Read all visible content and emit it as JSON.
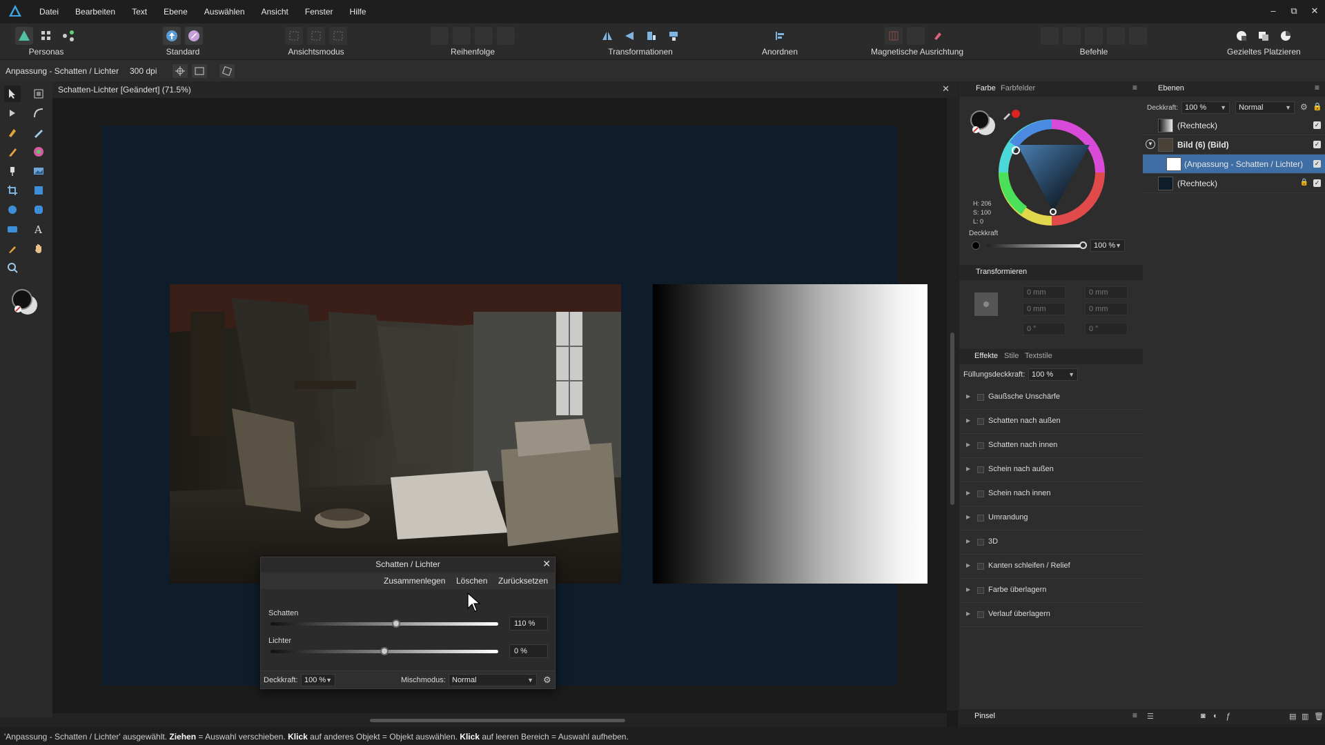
{
  "app": {
    "menus": [
      "Datei",
      "Bearbeiten",
      "Text",
      "Ebene",
      "Auswählen",
      "Ansicht",
      "Fenster",
      "Hilfe"
    ],
    "window_controls": [
      "–",
      "⧉",
      "✕"
    ]
  },
  "toolbar": {
    "personas": "Personas",
    "standard": "Standard",
    "ansichtsmodus": "Ansichtsmodus",
    "reihenfolge": "Reihenfolge",
    "transformationen": "Transformationen",
    "anordnen": "Anordnen",
    "magnetische_ausrichtung": "Magnetische Ausrichtung",
    "befehle": "Befehle",
    "gezieltes_platzieren": "Gezieltes Platzieren"
  },
  "context": {
    "title": "Anpassung - Schatten / Lichter",
    "dpi": "300 dpi"
  },
  "document": {
    "tab_title": "Schatten-Lichter [Geändert] (71.5%)",
    "close": "✕"
  },
  "dialog": {
    "title": "Schatten / Lichter",
    "close": "✕",
    "merge": "Zusammenlegen",
    "delete": "Löschen",
    "reset": "Zurücksetzen",
    "shadows_label": "Schatten",
    "shadows_value": "110 %",
    "shadows_level": 0.55,
    "highlights_label": "Lichter",
    "highlights_value": "0 %",
    "highlights_level": 0.5,
    "opacity_label": "Deckkraft:",
    "opacity_value": "100 %",
    "blend_label": "Mischmodus:",
    "blend_value": "Normal"
  },
  "color_panel": {
    "tab_color": "Farbe",
    "tab_swatches": "Farbfelder",
    "h": "H: 206",
    "s": "S: 100",
    "l": "L: 0",
    "opacity_label": "Deckkraft",
    "opacity_value": "100 %"
  },
  "transform_panel": {
    "title": "Transformieren",
    "x": "0 mm",
    "y": "0 mm",
    "w": "0 mm",
    "h": "0 mm",
    "r": "0 °",
    "s": "0 °"
  },
  "effects_panel": {
    "tab_effects": "Effekte",
    "tab_styles": "Stile",
    "tab_textstyles": "Textstile",
    "fill_opacity_label": "Füllungsdeckkraft:",
    "fill_opacity_value": "100 %",
    "effects": [
      "Gaußsche Unschärfe",
      "Schatten nach außen",
      "Schatten nach innen",
      "Schein nach außen",
      "Schein nach innen",
      "Umrandung",
      "3D",
      "Kanten schleifen / Relief",
      "Farbe überlagern",
      "Verlauf überlagern"
    ],
    "brushes_tab": "Pinsel"
  },
  "layers_panel": {
    "title": "Ebenen",
    "opacity_label": "Deckkraft:",
    "opacity_value": "100 %",
    "blend_value": "Normal",
    "layers": [
      {
        "name": "(Rechteck)"
      },
      {
        "name": "Bild (6) (Bild)"
      },
      {
        "name": "(Anpassung - Schatten / Lichter)"
      },
      {
        "name": "(Rechteck)"
      }
    ]
  },
  "status": {
    "p1": "'Anpassung - Schatten / Lichter' ausgewählt. ",
    "b1": "Ziehen",
    "p2": " = Auswahl verschieben. ",
    "b2": "Klick",
    "p3": " auf anderes Objekt = Objekt auswählen. ",
    "b3": "Klick",
    "p4": " auf leeren Bereich = Auswahl aufheben."
  },
  "colors": {
    "accent": "#3f6ea5",
    "canvas": "#0f1d2b"
  }
}
